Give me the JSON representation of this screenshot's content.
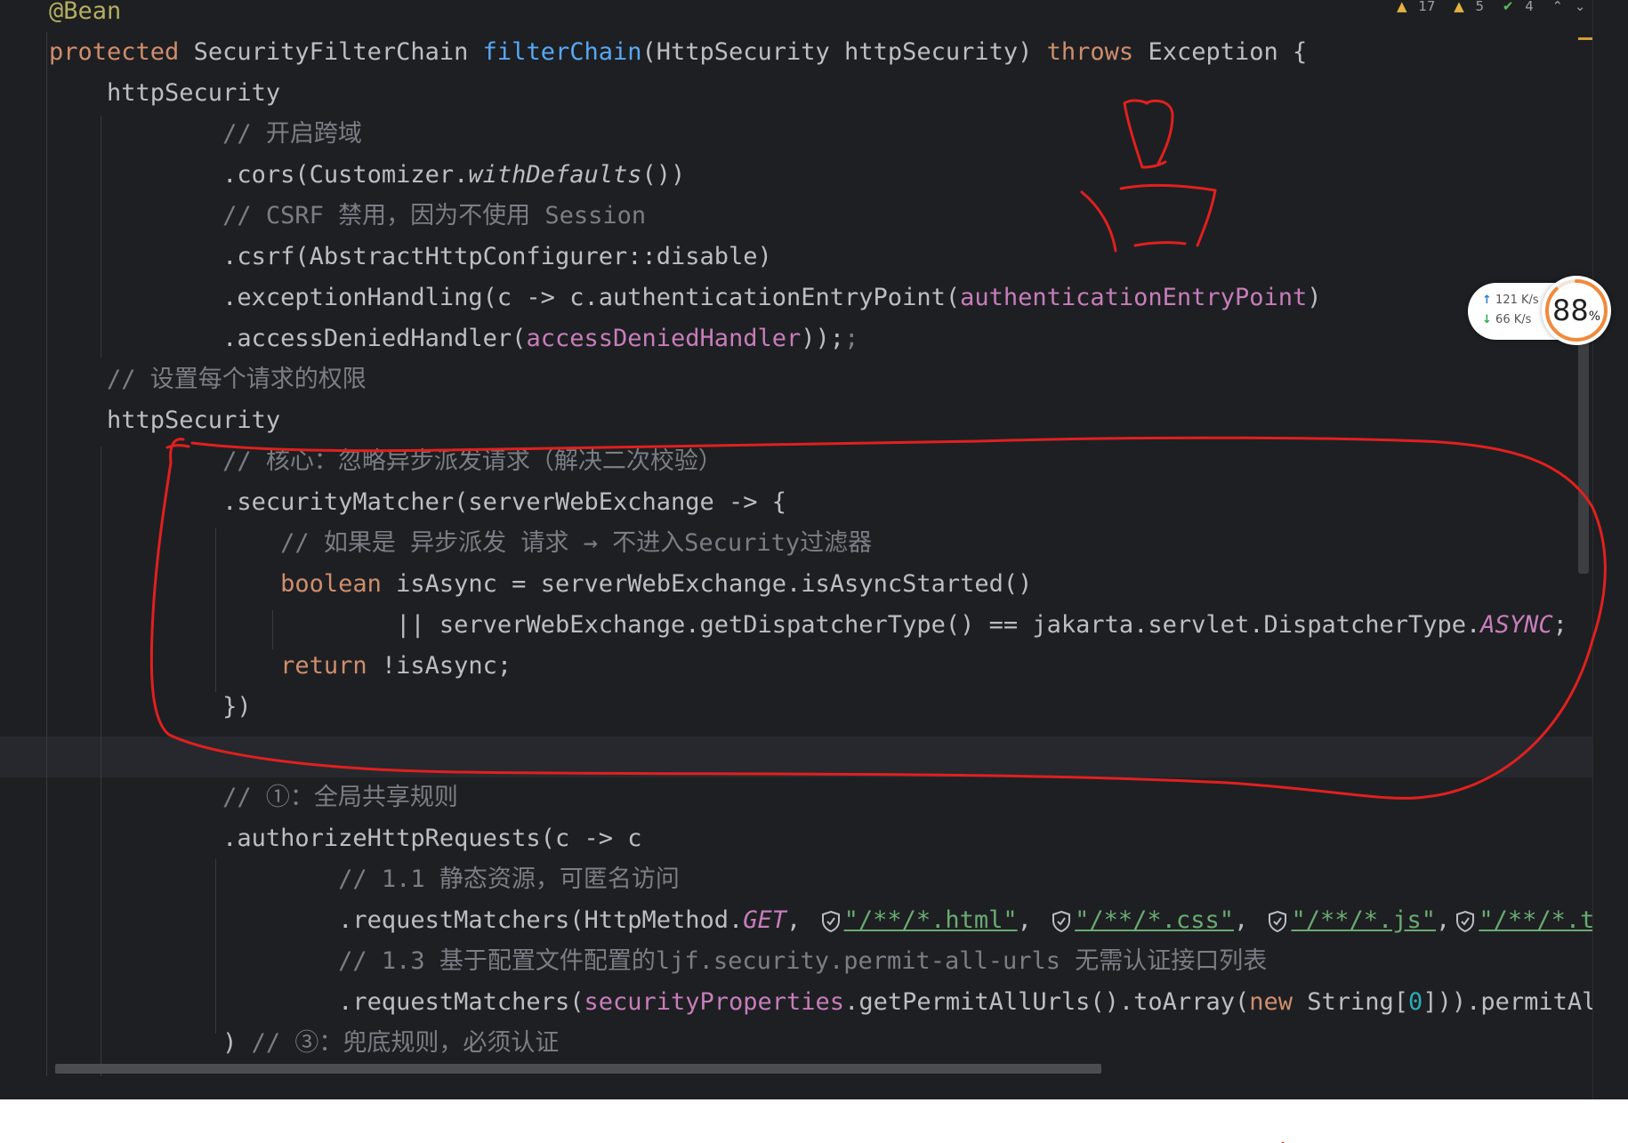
{
  "inspections": {
    "warnings_count": "17",
    "weak_warnings_count": "5",
    "ok_count": "4"
  },
  "code_lines": [
    {
      "tokens": [
        {
          "t": "@Bean",
          "c": "ann"
        }
      ]
    },
    {
      "tokens": [
        {
          "t": "protected ",
          "c": "kw"
        },
        {
          "t": "SecurityFilterChain "
        },
        {
          "t": "filterChain",
          "c": "fn"
        },
        {
          "t": "(HttpSecurity httpSecurity) "
        },
        {
          "t": "throws ",
          "c": "kw"
        },
        {
          "t": "Exception {"
        }
      ]
    },
    {
      "tokens": [
        {
          "t": "    httpSecurity"
        }
      ]
    },
    {
      "tokens": [
        {
          "t": "            "
        },
        {
          "t": "// 开启跨域",
          "c": "cm"
        }
      ]
    },
    {
      "tokens": [
        {
          "t": "            .cors(Customizer."
        },
        {
          "t": "withDefaults",
          "c": "ital"
        },
        {
          "t": "())"
        }
      ]
    },
    {
      "tokens": [
        {
          "t": "            "
        },
        {
          "t": "// CSRF 禁用，因为不使用 Session",
          "c": "cm"
        }
      ]
    },
    {
      "tokens": [
        {
          "t": "            .csrf(AbstractHttpConfigurer::disable)"
        }
      ]
    },
    {
      "tokens": [
        {
          "t": "            .exceptionHandling(c -> c.authenticationEntryPoint("
        },
        {
          "t": "authenticationEntryPoint",
          "c": "fld"
        },
        {
          "t": ")"
        }
      ]
    },
    {
      "tokens": [
        {
          "t": "            .accessDeniedHandler("
        },
        {
          "t": "accessDeniedHandler",
          "c": "fld"
        },
        {
          "t": "));"
        },
        {
          "t": ";",
          "c": "cm"
        }
      ]
    },
    {
      "tokens": [
        {
          "t": "    "
        },
        {
          "t": "// 设置每个请求的权限",
          "c": "cm"
        }
      ]
    },
    {
      "tokens": [
        {
          "t": "    httpSecurity"
        }
      ]
    },
    {
      "tokens": [
        {
          "t": "            "
        },
        {
          "t": "// 核心：忽略异步派发请求（解决二次校验）",
          "c": "cm"
        }
      ]
    },
    {
      "tokens": [
        {
          "t": "            .securityMatcher(serverWebExchange -> {"
        }
      ]
    },
    {
      "tokens": [
        {
          "t": "                "
        },
        {
          "t": "// 如果是 异步派发 请求 → 不进入Security过滤器",
          "c": "cm"
        }
      ]
    },
    {
      "tokens": [
        {
          "t": "                "
        },
        {
          "t": "boolean ",
          "c": "kw"
        },
        {
          "t": "isAsync = serverWebExchange.isAsyncStarted()"
        }
      ]
    },
    {
      "tokens": [
        {
          "t": "                        || serverWebExchange.getDispatcherType() == jakarta.servlet.DispatcherType."
        },
        {
          "t": "ASYNC",
          "c": "fld ital"
        },
        {
          "t": ";"
        }
      ]
    },
    {
      "tokens": [
        {
          "t": "                "
        },
        {
          "t": "return ",
          "c": "kw"
        },
        {
          "t": "!isAsync;"
        }
      ]
    },
    {
      "tokens": [
        {
          "t": "            })"
        }
      ]
    },
    {
      "tokens": []
    },
    {
      "tokens": [
        {
          "t": "            "
        },
        {
          "t": "// ①：全局共享规则",
          "c": "cm"
        }
      ]
    },
    {
      "tokens": [
        {
          "t": "            .authorizeHttpRequests(c -> c"
        }
      ]
    },
    {
      "tokens": [
        {
          "t": "                    "
        },
        {
          "t": "// 1.1 静态资源，可匿名访问",
          "c": "cm"
        }
      ]
    },
    {
      "tokens": [
        {
          "t": "                    .requestMatchers(HttpMethod."
        },
        {
          "t": "GET",
          "c": "fld ital"
        },
        {
          "t": ", "
        },
        {
          "shield": "shield-icon"
        },
        {
          "t": "\"/**/*.html\"",
          "c": "str"
        },
        {
          "t": ", "
        },
        {
          "shield": "shield-icon"
        },
        {
          "t": "\"/**/*.css\"",
          "c": "str"
        },
        {
          "t": ", "
        },
        {
          "shield": "shield-icon"
        },
        {
          "t": "\"/**/*.js\"",
          "c": "str"
        },
        {
          "t": ","
        },
        {
          "shield": "shield-icon"
        },
        {
          "t": "\"/**/*.tx",
          "c": "str"
        }
      ]
    },
    {
      "tokens": [
        {
          "t": "                    "
        },
        {
          "t": "// 1.3 基于配置文件配置的ljf.security.permit-all-urls 无需认证接口列表",
          "c": "cm"
        }
      ]
    },
    {
      "tokens": [
        {
          "t": "                    .requestMatchers("
        },
        {
          "t": "securityProperties",
          "c": "fld"
        },
        {
          "t": ".getPermitAllUrls().toArray("
        },
        {
          "t": "new ",
          "c": "kw"
        },
        {
          "t": "String["
        },
        {
          "t": "0",
          "c": "num"
        },
        {
          "t": "])).permitAll"
        }
      ]
    },
    {
      "tokens": [
        {
          "t": "            ) "
        },
        {
          "t": "// ③：兜底规则，必须认证",
          "c": "cm"
        }
      ]
    }
  ],
  "network_widget": {
    "upload_speed": "121 K/s",
    "download_speed": "66  K/s",
    "gauge_value": "88",
    "gauge_unit": "%",
    "gauge_fraction": 0.88
  },
  "colors": {
    "editor_bg": "#1e1f22",
    "keyword": "#cf8e6d",
    "function": "#56a8f5",
    "annotation": "#b3ae60",
    "comment": "#7a7e85",
    "field": "#c77dbb",
    "string": "#6aab73",
    "ink_red": "#e0201f"
  }
}
